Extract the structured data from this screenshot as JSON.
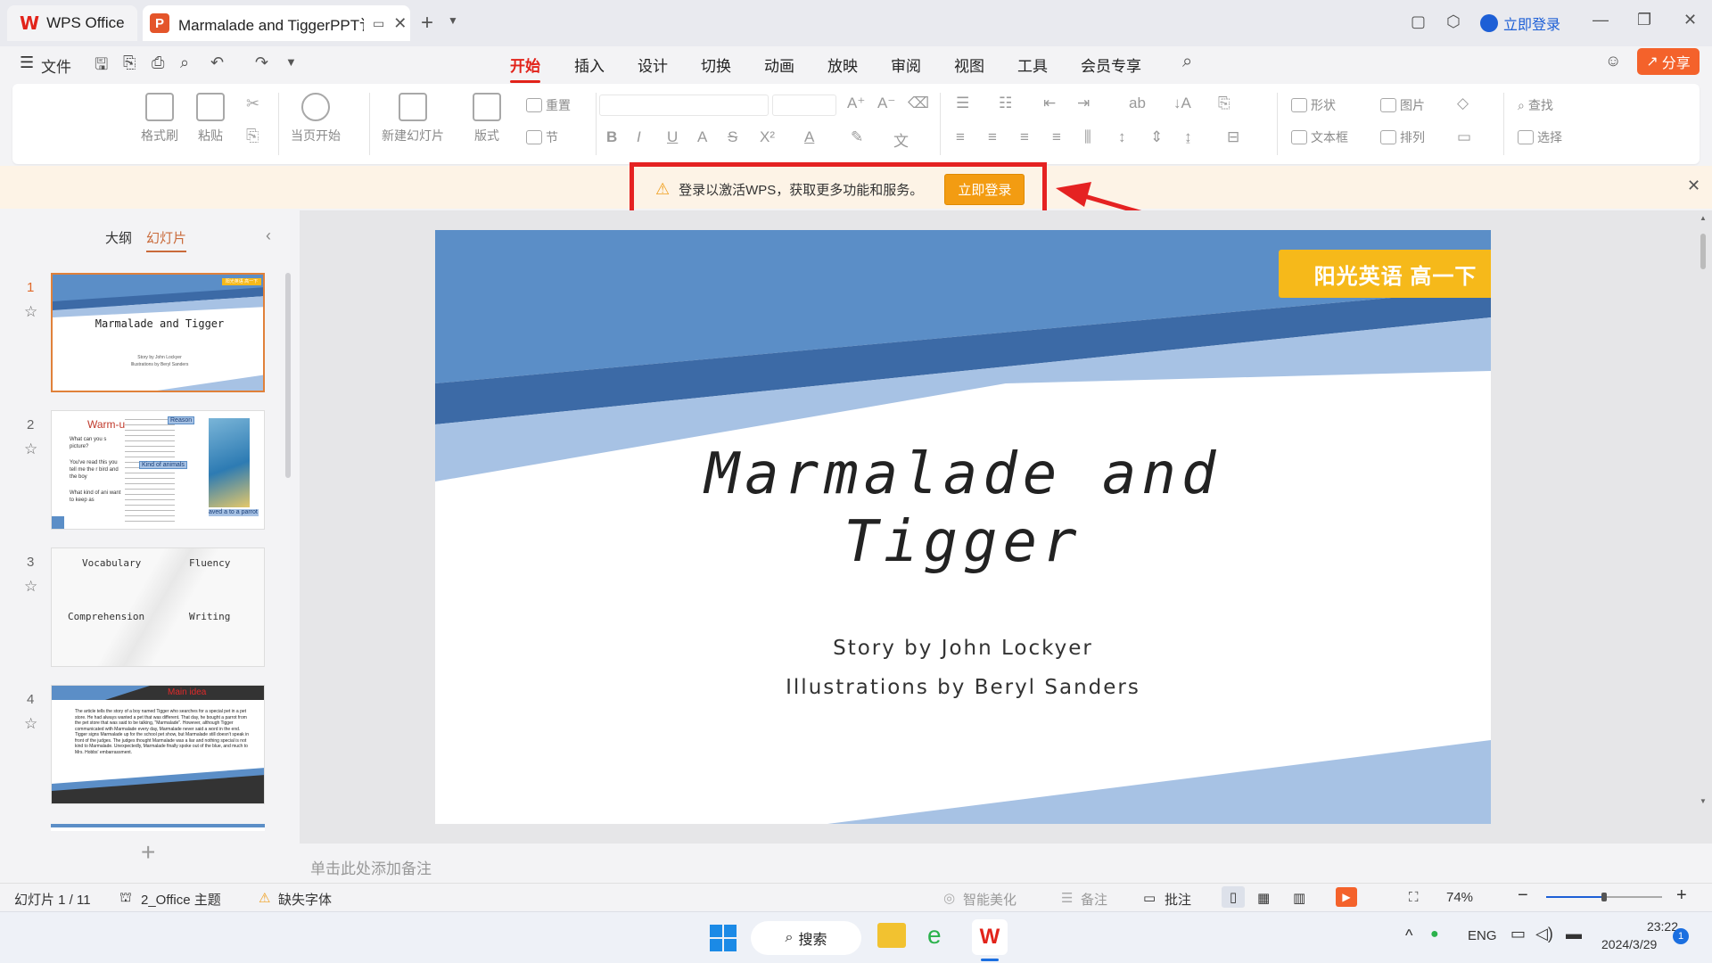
{
  "tabs": {
    "home_label": "WPS Office",
    "doc_title": "Marmalade and TiggerPPT讠"
  },
  "titlebar": {
    "login_label": "立即登录"
  },
  "menu": {
    "file_label": "文件",
    "tabs": [
      "开始",
      "插入",
      "设计",
      "切换",
      "动画",
      "放映",
      "审阅",
      "视图",
      "工具",
      "会员专享"
    ],
    "active_tab": "开始",
    "share_label": "分享"
  },
  "ribbon": {
    "format_painter": "格式刷",
    "paste": "粘贴",
    "start_current": "当页开始",
    "new_slide": "新建幻灯片",
    "layout": "版式",
    "reset": "重置",
    "section": "节",
    "shape": "形状",
    "picture": "图片",
    "textbox": "文本框",
    "arrange": "排列",
    "find": "查找",
    "select": "选择"
  },
  "notice": {
    "text": "登录以激活WPS，获取更多功能和服务。",
    "button": "立即登录"
  },
  "sidebar": {
    "outline_tab": "大纲",
    "slides_tab": "幻灯片",
    "active_tab": "幻灯片"
  },
  "thumbnails": [
    {
      "num": "1",
      "title": "Marmalade and Tigger",
      "line1": "Story by John Lockyer",
      "line2": "Illustrations by Beryl Sanders",
      "badge": "阳光英语 高一下"
    },
    {
      "num": "2",
      "title": "Warm-up",
      "bullets": [
        "What can you s picture?",
        "You've read this you tell me the r bird and the boy",
        "What kind of ani want to keep as"
      ],
      "labels": [
        "Reason",
        "Kind of animals",
        "aved a to a parrot"
      ]
    },
    {
      "num": "3",
      "quadrants": [
        "Vocabulary",
        "Fluency",
        "Comprehension",
        "Writing"
      ]
    },
    {
      "num": "4",
      "title": "Main idea",
      "body": "The article tells the story of a boy named Tigger who searches for a special pet in a pet store. He had always wanted a pet that was different. That day, he bought a parrot from the pet store that was said to be talking, \"Marmalade\". However, although Tigger communicated with Marmalade every day, Marmalade never said a word in the end. Tigger signs Marmalade up for the school pet show, but Marmalade still doesn't speak in front of the judges. The judges thought Marmalade was a liar and nothing special is not kind to Marmalade. Unexpectedly, Marmalade finally spoke out of the blue, and much to Mrs. Hobbs' embarrassment."
    }
  ],
  "slide": {
    "badge": "阳光英语 高一下",
    "title_line1": "Marmalade and",
    "title_line2": "Tigger",
    "byline1": "Story by John Lockyer",
    "byline2": "Illustrations by Beryl Sanders"
  },
  "notes_placeholder": "单击此处添加备注",
  "status": {
    "slide_counter": "幻灯片 1 / 11",
    "theme": "2_Office 主题",
    "missing_font": "缺失字体",
    "smart_beautify": "智能美化",
    "notes": "备注",
    "comments": "批注",
    "zoom": "74%",
    "zoom_level": 0.5
  },
  "taskbar": {
    "search": "搜索",
    "lang": "ENG",
    "time": "23:22",
    "date": "2024/3/29",
    "notif_count": "1"
  },
  "colors": {
    "accent": "#e2231a",
    "slide_blue": "#5b8ec7",
    "slide_dark_blue": "#3c6aa6",
    "slide_light_blue": "#a7c2e4",
    "badge": "#f6b91a",
    "notice_btn": "#f39c12",
    "highlight_red": "#e52222",
    "share": "#f4622b"
  }
}
